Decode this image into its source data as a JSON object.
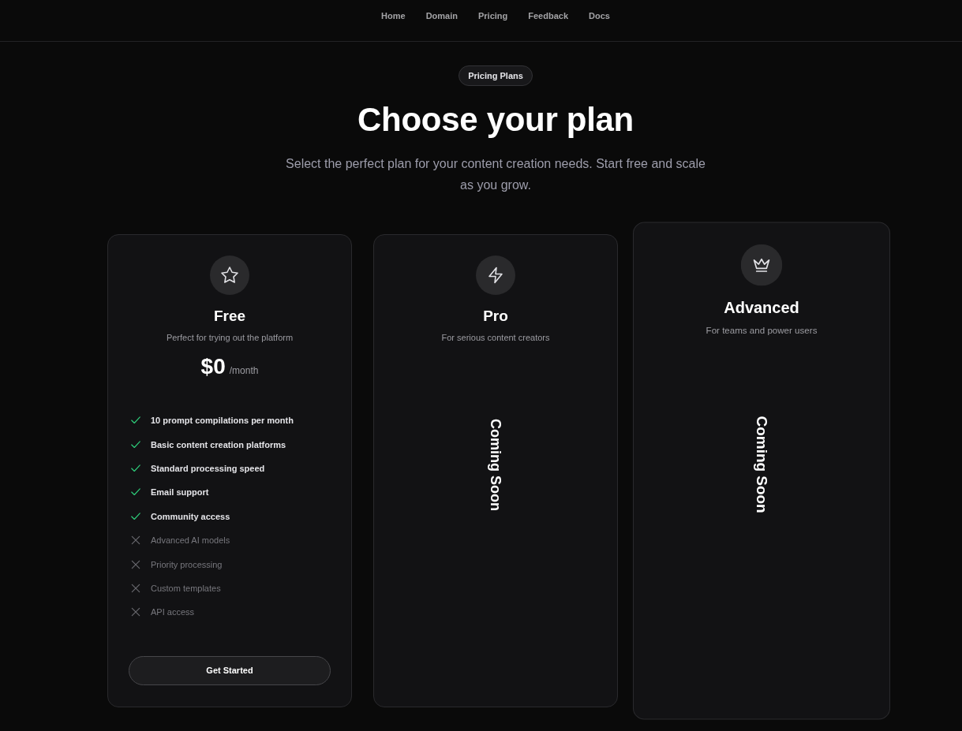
{
  "nav": {
    "links": [
      "Home",
      "Domain",
      "Pricing",
      "Feedback",
      "Docs"
    ]
  },
  "hero": {
    "badge": "Pricing Plans",
    "title": "Choose your plan",
    "subtitle": "Select the perfect plan for your content creation needs. Start free and scale as you grow."
  },
  "plans": [
    {
      "kind": "available",
      "featured": false,
      "name": "Free",
      "description": "Perfect for trying out the platform",
      "price": "$0",
      "period": "/month",
      "features": [
        {
          "label": "10 prompt compilations per month",
          "included": true
        },
        {
          "label": "Basic content creation platforms",
          "included": true
        },
        {
          "label": "Standard processing speed",
          "included": true
        },
        {
          "label": "Email support",
          "included": true
        },
        {
          "label": "Community access",
          "included": true
        },
        {
          "label": "Advanced AI models",
          "included": false
        },
        {
          "label": "Priority processing",
          "included": false
        },
        {
          "label": "Custom templates",
          "included": false
        },
        {
          "label": "API access",
          "included": false
        }
      ],
      "button": "Get Started"
    },
    {
      "kind": "coming_soon",
      "featured": false,
      "name": "Pro",
      "description": "For serious content creators",
      "status": "Coming Soon"
    },
    {
      "kind": "coming_soon",
      "featured": true,
      "name": "Advanced",
      "description": "For teams and power users",
      "status": "Coming Soon"
    }
  ]
}
